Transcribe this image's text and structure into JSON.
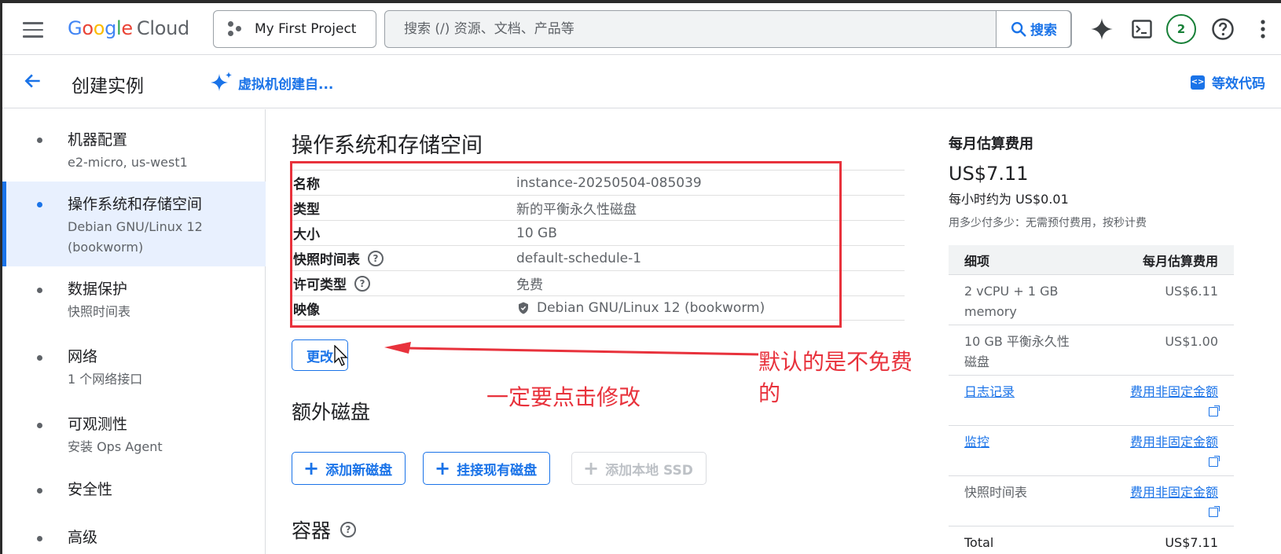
{
  "topbar": {
    "brand_google": [
      "G",
      "o",
      "o",
      "g",
      "l",
      "e"
    ],
    "brand_cloud": "Cloud",
    "project": "My First Project",
    "search_placeholder": "搜索 (/) 资源、文档、产品等",
    "search_button": "搜索",
    "notifications_count": "2"
  },
  "subbar": {
    "title": "创建实例",
    "ai_link": "虚拟机创建自...",
    "equivalent_code": "等效代码"
  },
  "nav": {
    "items": [
      {
        "title": "机器配置",
        "sub": "e2-micro, us-west1"
      },
      {
        "title": "操作系统和存储空间",
        "sub": "Debian GNU/Linux 12",
        "sub2": "(bookworm)"
      },
      {
        "title": "数据保护",
        "sub": "快照时间表"
      },
      {
        "title": "网络",
        "sub": "1 个网络接口"
      },
      {
        "title": "可观测性",
        "sub": "安装 Ops Agent"
      },
      {
        "title": "安全性"
      },
      {
        "title": "高级"
      }
    ]
  },
  "main": {
    "section_title": "操作系统和存储空间",
    "properties": [
      {
        "label": "名称",
        "value": "instance-20250504-085039"
      },
      {
        "label": "类型",
        "value": "新的平衡永久性磁盘"
      },
      {
        "label": "大小",
        "value": "10 GB"
      },
      {
        "label": "快照时间表",
        "value": "default-schedule-1",
        "help": "?"
      },
      {
        "label": "许可类型",
        "value": "免费",
        "help": "?"
      },
      {
        "label": "映像",
        "value": "Debian GNU/Linux 12 (bookworm)"
      }
    ],
    "change_button": "更改",
    "annotation_default": "默认的是不免费的",
    "annotation_click": "一定要点击修改",
    "extra_disks_title": "额外磁盘",
    "add_new_disk": "添加新磁盘",
    "attach_existing_disk": "挂接现有磁盘",
    "add_local_ssd": "添加本地 SSD",
    "containers_title": "容器",
    "containers_help": "?"
  },
  "pricing": {
    "title": "每月估算费用",
    "price": "US$7.11",
    "hourly": "每小时约为 US$0.01",
    "note": "用多少付多少：无需预付费用，按秒计费",
    "table_head_left": "细项",
    "table_head_right": "每月估算费用",
    "rows": [
      {
        "item": "2 vCPU + 1 GB memory",
        "cost": "US$6.11"
      },
      {
        "item": "10 GB 平衡永久性磁盘",
        "cost": "US$1.00"
      },
      {
        "item": "日志记录",
        "cost": "费用非固定金额"
      },
      {
        "item": "监控",
        "cost": "费用非固定金额"
      },
      {
        "item": "快照时间表",
        "cost": "费用非固定金额"
      },
      {
        "item": "Total",
        "cost": "US$7.11"
      }
    ]
  },
  "colors": {
    "accent": "#1a73e8",
    "annotation_red": "#e8323c",
    "active_nav_bg": "#e8f0fe",
    "badge_green": "#188038"
  },
  "icons": [
    "menu-icon",
    "project-icon",
    "search-icon",
    "gemini-icon",
    "cloud-shell-icon",
    "help-icon",
    "more-vert-icon",
    "back-arrow-icon",
    "sparkle-icon",
    "code-icon",
    "shield-icon",
    "plus-icon",
    "external-link-icon",
    "cursor-icon"
  ]
}
